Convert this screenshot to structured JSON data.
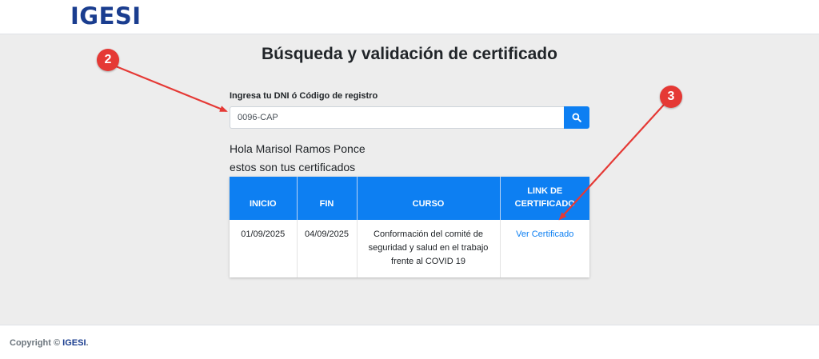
{
  "header": {
    "logo_text": "IGESI"
  },
  "page": {
    "title": "Búsqueda y validación de certificado"
  },
  "search": {
    "label": "Ingresa tu DNI ó Código de registro",
    "value": "0096-CAP",
    "button_icon": "search-icon"
  },
  "greeting": {
    "line1": "Hola Marisol Ramos Ponce",
    "line2": "estos son tus certificados"
  },
  "table": {
    "headers": {
      "inicio": "INICIO",
      "fin": "FIN",
      "curso": "CURSO",
      "link": "LINK DE CERTIFICADO"
    },
    "rows": [
      {
        "inicio": "01/09/2025",
        "fin": "04/09/2025",
        "curso": "Conformación del comité de seguridad y salud en el trabajo frente al COVID 19",
        "link": "Ver Certificado"
      }
    ]
  },
  "footer": {
    "copyright_prefix": "Copyright ©",
    "brand": "IGESI",
    "suffix": "."
  },
  "annotations": {
    "badge_2": "2",
    "badge_3": "3",
    "color": "#e53935"
  },
  "colors": {
    "primary": "#0d7ff2",
    "brand": "#1a3d8f",
    "page_bg": "#ededed"
  }
}
